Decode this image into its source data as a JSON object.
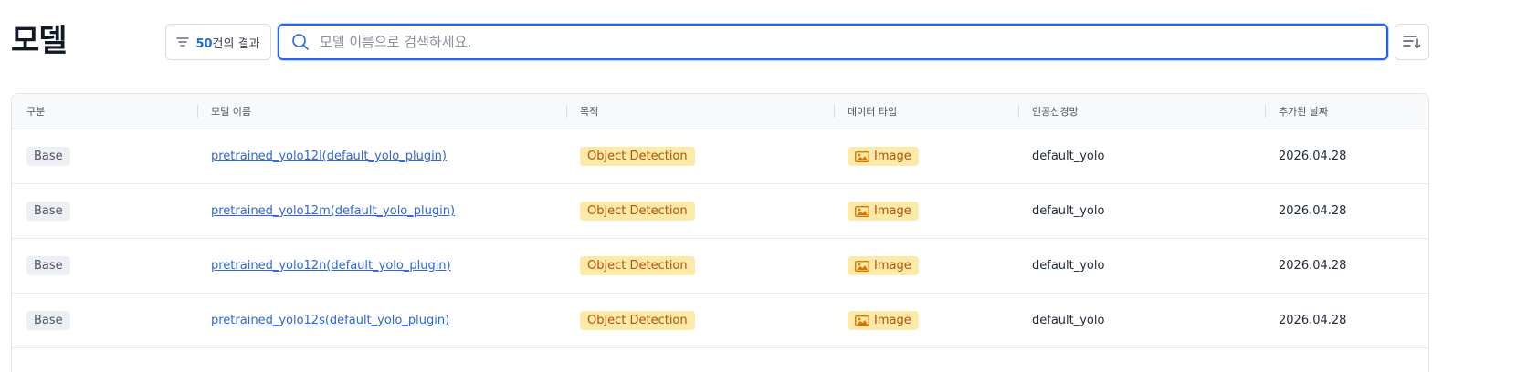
{
  "header": {
    "title": "모델"
  },
  "filter": {
    "count": "50",
    "suffix": "건의 결과"
  },
  "search": {
    "placeholder": "모델 이름으로 검색하세요.",
    "value": ""
  },
  "table": {
    "columns": [
      "구분",
      "모델 이름",
      "목적",
      "데이터 타입",
      "인공신경망",
      "추가된 날짜"
    ],
    "rows": [
      {
        "category": "Base",
        "name": "pretrained_yolo12l(default_yolo_plugin)",
        "purpose": "Object Detection",
        "data_type": "Image",
        "network": "default_yolo",
        "date": "2026.04.28"
      },
      {
        "category": "Base",
        "name": "pretrained_yolo12m(default_yolo_plugin)",
        "purpose": "Object Detection",
        "data_type": "Image",
        "network": "default_yolo",
        "date": "2026.04.28"
      },
      {
        "category": "Base",
        "name": "pretrained_yolo12n(default_yolo_plugin)",
        "purpose": "Object Detection",
        "data_type": "Image",
        "network": "default_yolo",
        "date": "2026.04.28"
      },
      {
        "category": "Base",
        "name": "pretrained_yolo12s(default_yolo_plugin)",
        "purpose": "Object Detection",
        "data_type": "Image",
        "network": "default_yolo",
        "date": "2026.04.28"
      }
    ]
  },
  "icons": {
    "filter": "filter-lines-icon",
    "search": "search-icon",
    "sort": "sort-list-icon",
    "image": "image-icon"
  },
  "colors": {
    "accent": "#2563eb",
    "link": "#2f66d9",
    "badge_yellow_bg": "#fde9a8",
    "badge_yellow_text": "#b45309"
  }
}
